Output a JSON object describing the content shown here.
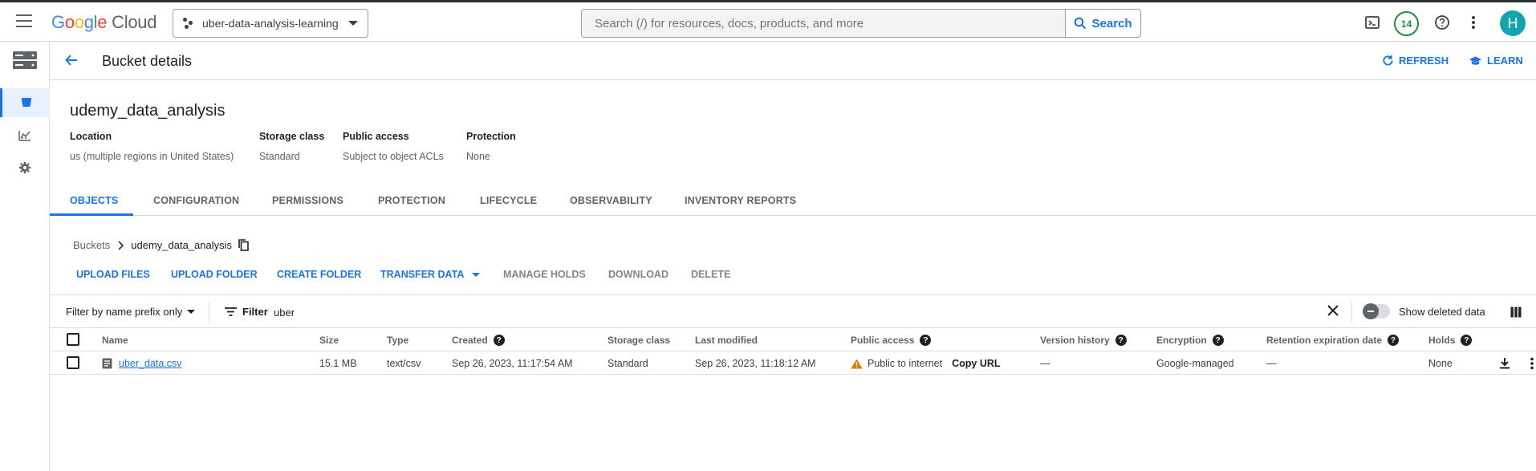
{
  "header": {
    "logo_google": "Google",
    "logo_cloud": "Cloud",
    "project": "uber-data-analysis-learning",
    "search_placeholder": "Search (/) for resources, docs, products, and more",
    "search_button": "Search",
    "notifications_count": "14",
    "avatar_letter": "H"
  },
  "page": {
    "title": "Bucket details",
    "refresh": "REFRESH",
    "learn": "LEARN"
  },
  "bucket": {
    "name": "udemy_data_analysis",
    "meta": [
      {
        "key": "Location",
        "value": "us (multiple regions in United States)"
      },
      {
        "key": "Storage class",
        "value": "Standard"
      },
      {
        "key": "Public access",
        "value": "Subject to object ACLs"
      },
      {
        "key": "Protection",
        "value": "None"
      }
    ]
  },
  "tabs": [
    "OBJECTS",
    "CONFIGURATION",
    "PERMISSIONS",
    "PROTECTION",
    "LIFECYCLE",
    "OBSERVABILITY",
    "INVENTORY REPORTS"
  ],
  "breadcrumb": {
    "root": "Buckets",
    "current": "udemy_data_analysis"
  },
  "actions": {
    "upload_files": "UPLOAD FILES",
    "upload_folder": "UPLOAD FOLDER",
    "create_folder": "CREATE FOLDER",
    "transfer_data": "TRANSFER DATA",
    "manage_holds": "MANAGE HOLDS",
    "download": "DOWNLOAD",
    "delete": "DELETE"
  },
  "filter": {
    "prefix_label": "Filter by name prefix only",
    "filter_label": "Filter",
    "value": "uber",
    "show_deleted": "Show deleted data"
  },
  "table": {
    "columns": [
      "Name",
      "Size",
      "Type",
      "Created",
      "Storage class",
      "Last modified",
      "Public access",
      "Version history",
      "Encryption",
      "Retention expiration date",
      "Holds"
    ],
    "rows": [
      {
        "name": "uber_data.csv",
        "size": "15.1 MB",
        "type": "text/csv",
        "created": "Sep 26, 2023, 11:17:54 AM",
        "storage_class": "Standard",
        "last_modified": "Sep 26, 2023, 11:18:12 AM",
        "public_access": "Public to internet",
        "copy_url": "Copy URL",
        "version_history": "—",
        "encryption": "Google-managed",
        "retention": "—",
        "holds": "None"
      }
    ]
  },
  "colors": {
    "accent": "#1a73e8",
    "warning": "#e37400",
    "active_tab_bg": "#e8f0fe"
  }
}
